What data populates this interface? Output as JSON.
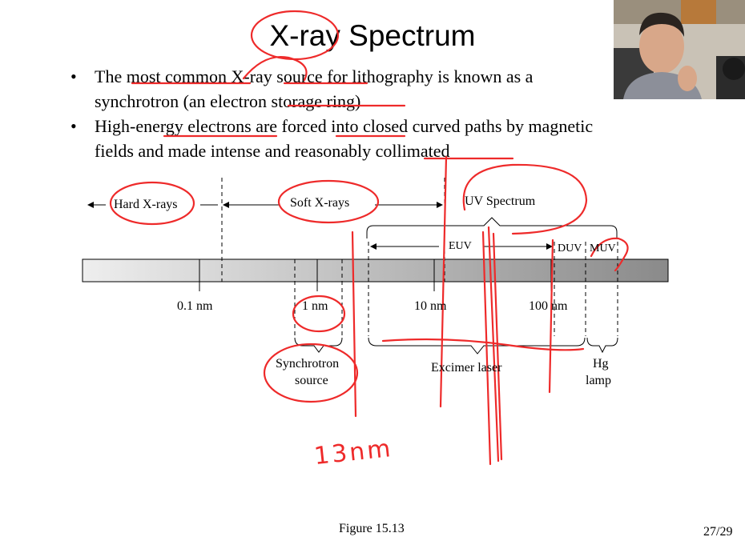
{
  "slide": {
    "title": "X-ray Spectrum",
    "bullets": [
      {
        "line1": "The most common X-ray source for lithography is known as a",
        "line2": "synchrotron (an electron storage ring)"
      },
      {
        "line1": "High-energy electrons are forced into closed curved paths by magnetic",
        "line2": "fields and made intense and reasonably collimated"
      }
    ],
    "figure": {
      "hard_xrays": "Hard X-rays",
      "soft_xrays": "Soft X-rays",
      "uv_spectrum": "UV Spectrum",
      "euv": "EUV",
      "duv": "DUV",
      "muv": "MUV",
      "tick_labels": [
        "0.1 nm",
        "1 nm",
        "10 nm",
        "100 nm"
      ],
      "synchrotron_line1": "Synchrotron",
      "synchrotron_line2": "source",
      "excimer": "Excimer laser",
      "hg_line1": "Hg",
      "hg_line2": "lamp"
    },
    "annotation": "13nm",
    "caption": "Figure 15.13",
    "page": "27/29"
  },
  "colors": {
    "ink": "#ee2a2a",
    "bar_light": "#eeeeee",
    "bar_dark": "#8a8a8a"
  },
  "icons": [
    "bullet-dot",
    "arrow-left-icon",
    "arrow-right-icon"
  ]
}
